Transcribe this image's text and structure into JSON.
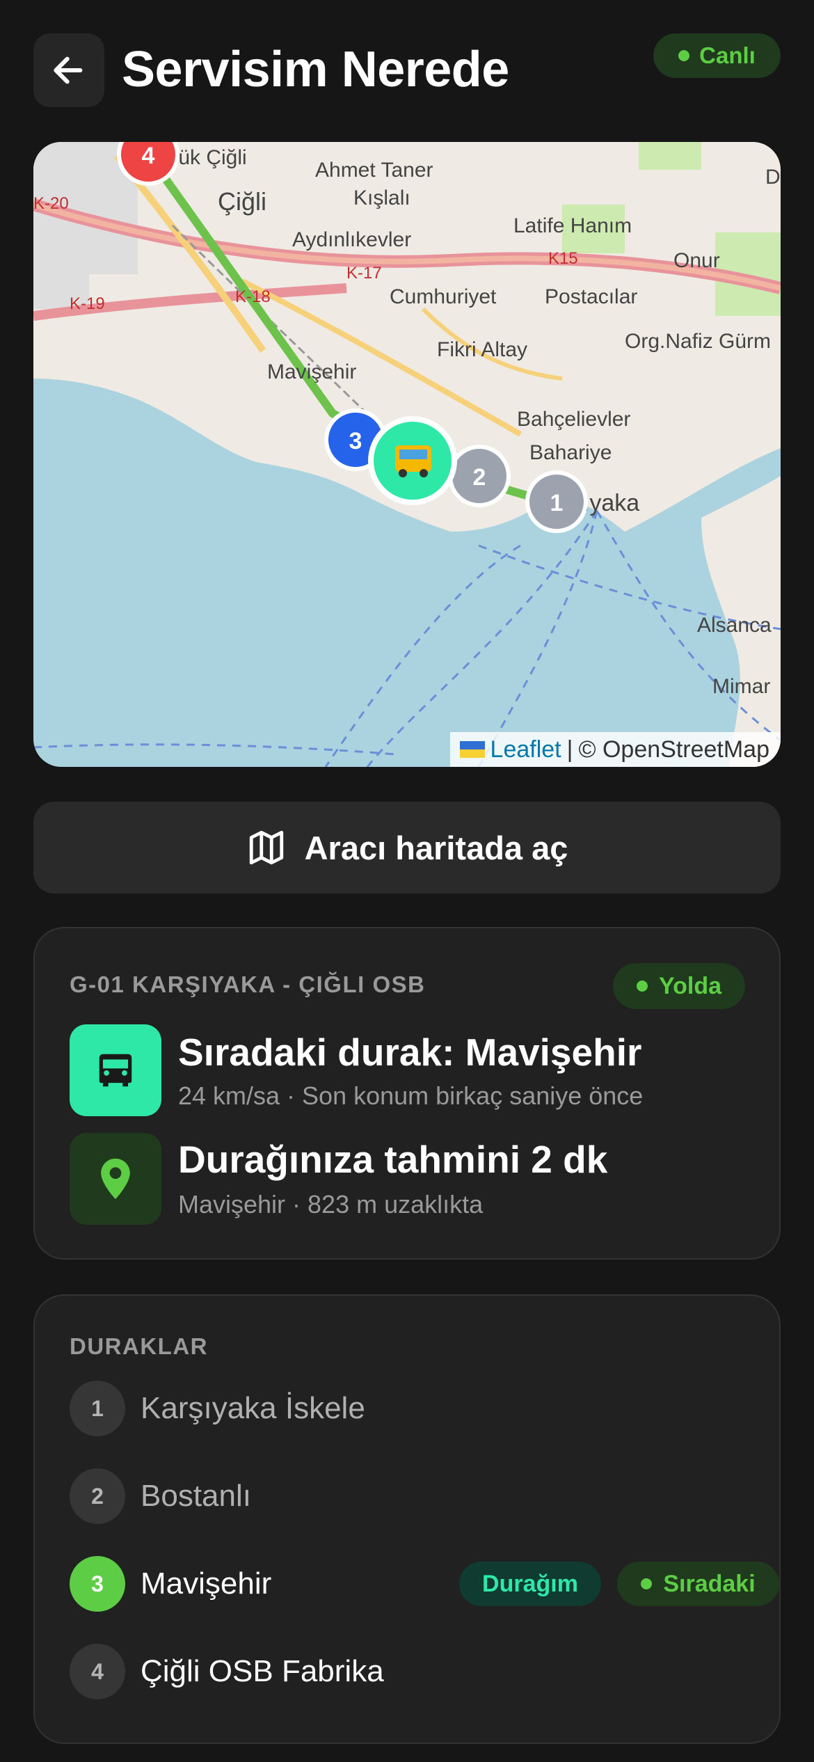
{
  "header": {
    "title": "Servisim Nerede",
    "live_label": "Canlı",
    "back_icon": "arrow-left-icon"
  },
  "colors": {
    "background": "#161616",
    "card": "#212121",
    "accent_green": "#5ccd44",
    "accent_mint": "#2ee8a8",
    "marker_blue": "#2563eb",
    "marker_red": "#ef4444",
    "marker_gray": "#9ca3af"
  },
  "map": {
    "place_labels": [
      "tük Çiğli",
      "Ahmet Taner",
      "Kışlalı",
      "Çiğli",
      "Latife Hanım",
      "Aydınlıkevler",
      "K-17",
      "K15",
      "Onur",
      "K-20",
      "K-19",
      "K-18",
      "Cumhuriyet",
      "Postacılar",
      "Org.Nafiz Gürm",
      "Fikri Altay",
      "Mavişehir",
      "Bahçelievler",
      "Bahariye",
      "Karşıyaka",
      "Alsanca",
      "Mimar",
      "D"
    ],
    "markers": [
      "4",
      "3",
      "2",
      "1"
    ],
    "vehicle_icon": "bus-emoji-icon",
    "attribution": {
      "leaflet": "Leaflet",
      "separator": "|",
      "osm": "© OpenStreetMap"
    }
  },
  "open_map_button": {
    "label": "Aracı haritada aç",
    "icon": "map-icon"
  },
  "trip": {
    "route_code": "G-01 KARŞIYAKA - ÇIĞLI OSB",
    "status": "Yolda",
    "next_stop_title": "Sıradaki durak: Mavişehir",
    "next_stop_sub": "24 km/sa · Son konum birkaç saniye önce",
    "eta_title": "Durağınıza tahmini 2 dk",
    "eta_sub": "Mavişehir · 823 m uzaklıkta",
    "bus_icon": "bus-icon",
    "pin_icon": "location-pin-icon"
  },
  "stops": {
    "heading": "DURAKLAR",
    "items": [
      {
        "num": "1",
        "name": "Karşıyaka İskele"
      },
      {
        "num": "2",
        "name": "Bostanlı"
      },
      {
        "num": "3",
        "name": "Mavişehir",
        "tag_mine": "Durağım",
        "tag_next": "Sıradaki"
      },
      {
        "num": "4",
        "name": "Çiğli OSB Fabrika"
      }
    ]
  }
}
